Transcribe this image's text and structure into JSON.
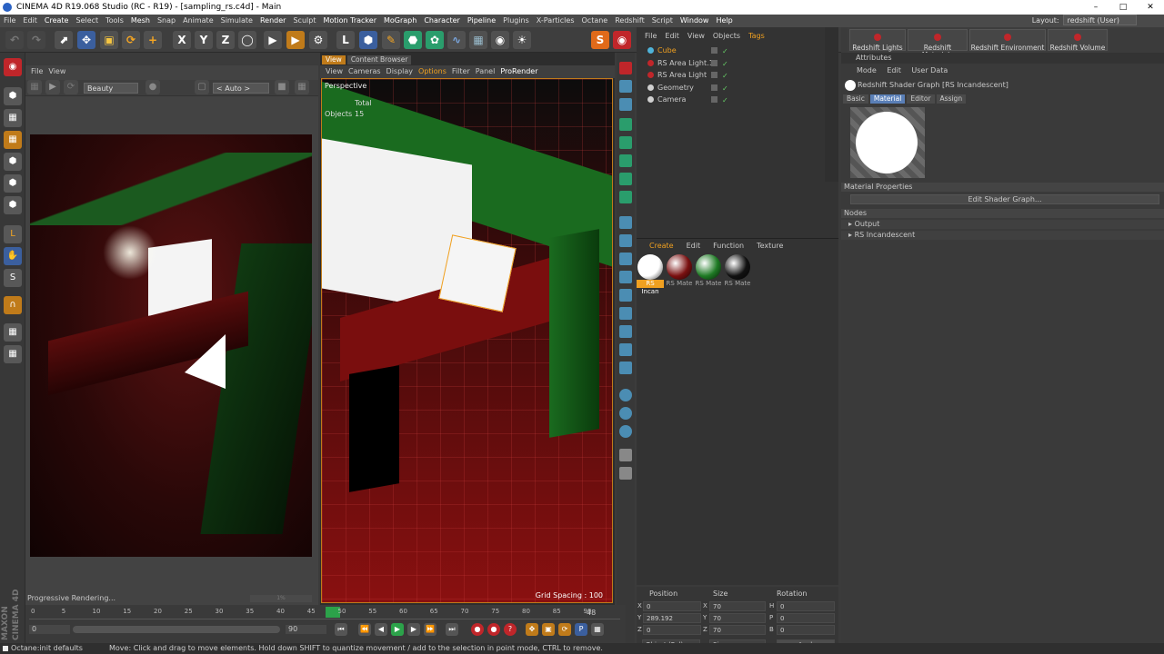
{
  "window": {
    "title": "CINEMA 4D R19.068 Studio (RC - R19) - [sampling_rs.c4d] - Main",
    "layout_label": "Layout:",
    "layout_value": "redshift (User)"
  },
  "menubar": [
    "File",
    "Edit",
    "Create",
    "Select",
    "Tools",
    "Mesh",
    "Snap",
    "Animate",
    "Simulate",
    "Render",
    "Sculpt",
    "Motion Tracker",
    "MoGraph",
    "Character",
    "Pipeline",
    "Plugins",
    "X-Particles",
    "Octane",
    "Redshift",
    "Script",
    "Window",
    "Help"
  ],
  "menubar_highlight": [
    "Create",
    "Mesh",
    "Render",
    "Motion Tracker",
    "MoGraph",
    "Character",
    "Pipeline",
    "Window",
    "Help"
  ],
  "render_view": {
    "menu": [
      "File",
      "View"
    ],
    "aov_select": "Beauty",
    "zoom_select": "< Auto >",
    "status": "Progressive Rendering...",
    "progress": "1%"
  },
  "viewport": {
    "tabs": [
      "View",
      "Content Browser"
    ],
    "menu": [
      "View",
      "Cameras",
      "Display",
      "Options",
      "Filter",
      "Panel",
      "ProRender"
    ],
    "camera_label": "Perspective",
    "stats_total_label": "Total",
    "stats_objects_label": "Objects",
    "stats_objects_value": "15",
    "grid_spacing": "Grid Spacing : 100"
  },
  "object_manager": {
    "menu": [
      "File",
      "Edit",
      "View",
      "Objects",
      "Tags"
    ],
    "objects": [
      {
        "name": "Cube",
        "color": "#4fb3d9",
        "selected": true
      },
      {
        "name": "RS Area Light.1",
        "color": "#c0262a",
        "selected": false
      },
      {
        "name": "RS Area Light",
        "color": "#c0262a",
        "selected": false
      },
      {
        "name": "Geometry",
        "color": "#cfcfcf",
        "selected": false
      },
      {
        "name": "Camera",
        "color": "#cfcfcf",
        "selected": false
      }
    ]
  },
  "material_manager": {
    "menu": [
      "Create",
      "Edit",
      "Function",
      "Texture"
    ],
    "materials": [
      {
        "label": "RS Incan",
        "color": "#ffffff",
        "selected": true
      },
      {
        "label": "RS Mate",
        "color": "#7a1010",
        "selected": false
      },
      {
        "label": "RS Mate",
        "color": "#1e7a24",
        "selected": false
      },
      {
        "label": "RS Mate",
        "color": "#111111",
        "selected": false
      }
    ]
  },
  "redshift_toolbar": [
    "Redshift Lights",
    "Redshift Materials",
    "Redshift Environment",
    "Redshift Volume"
  ],
  "attributes": {
    "header": "Attributes",
    "menu": [
      "Mode",
      "Edit",
      "User Data"
    ],
    "title": "Redshift Shader Graph [RS Incandescent]",
    "tabs": [
      "Basic",
      "Material",
      "Editor",
      "Assign"
    ],
    "active_tab": "Material",
    "section": "Material Properties",
    "edit_button": "Edit Shader Graph...",
    "nodes_label": "Nodes",
    "nodes": [
      "Output",
      "RS Incandescent"
    ]
  },
  "coordinates": {
    "headers": [
      "Position",
      "Size",
      "Rotation"
    ],
    "rows": [
      {
        "axis": "X",
        "pos": "0",
        "size_axis": "X",
        "size": "70",
        "rot_axis": "H",
        "rot": "0"
      },
      {
        "axis": "Y",
        "pos": "289.192",
        "size_axis": "Y",
        "size": "70",
        "rot_axis": "P",
        "rot": "0"
      },
      {
        "axis": "Z",
        "pos": "0",
        "size_axis": "Z",
        "size": "70",
        "rot_axis": "B",
        "rot": "0"
      }
    ],
    "mode_select": "Object (Rel)",
    "size_select": "Size",
    "apply_button": "Apply"
  },
  "timeline": {
    "ticks": [
      "0",
      "5",
      "10",
      "15",
      "20",
      "25",
      "30",
      "35",
      "40",
      "45",
      "48",
      "50",
      "55",
      "60",
      "65",
      "70",
      "75",
      "80",
      "85",
      "90"
    ],
    "current_frame": "48",
    "start_field": "0",
    "end_field": "90",
    "frame_right": "48"
  },
  "statusbar": {
    "left": "Octane:init defaults",
    "hint": "Move: Click and drag to move elements. Hold down SHIFT to quantize movement / add to the selection in point mode, CTRL to remove."
  }
}
